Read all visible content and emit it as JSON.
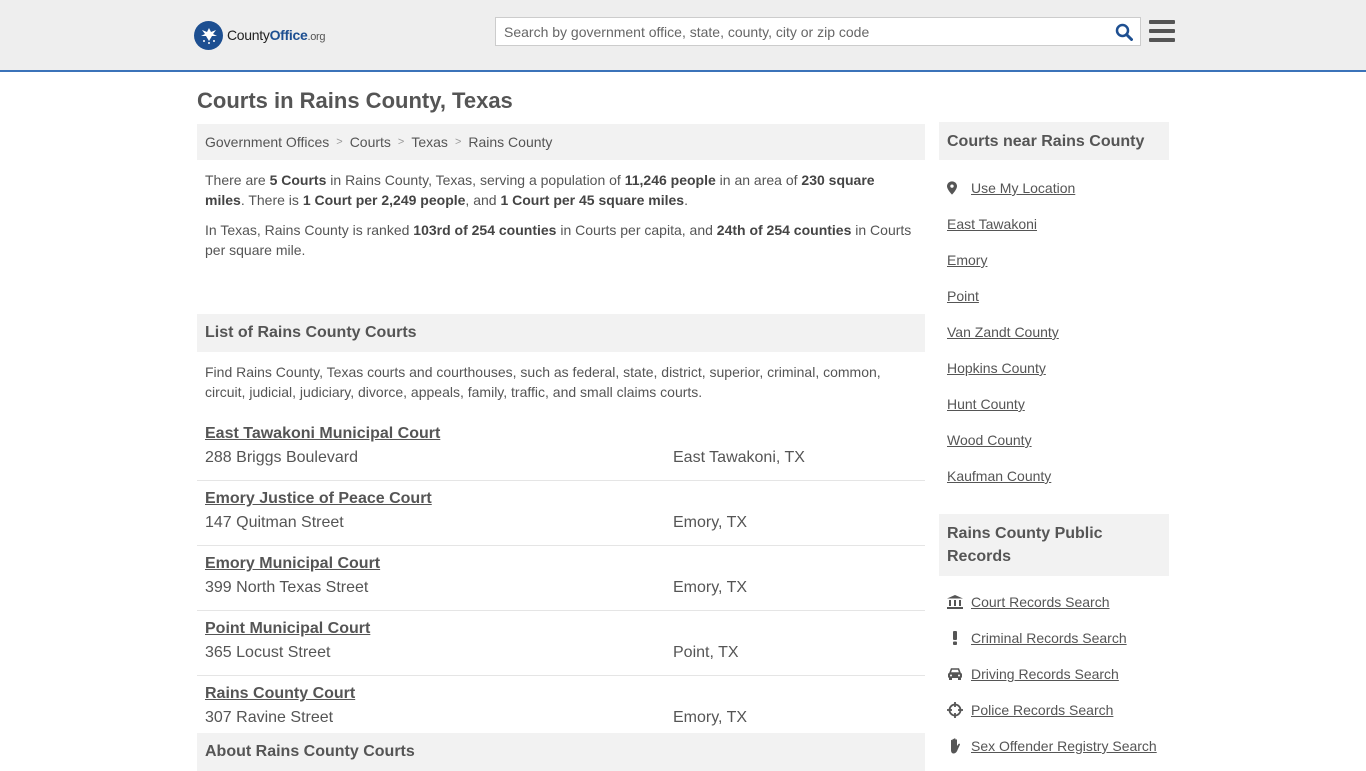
{
  "header": {
    "logo_text_main": "County",
    "logo_text_office": "Office",
    "logo_text_org": ".org",
    "search_placeholder": "Search by government office, state, county, city or zip code"
  },
  "page_title": "Courts in Rains County, Texas",
  "breadcrumb": [
    "Government Offices",
    "Courts",
    "Texas",
    "Rains County"
  ],
  "intro": {
    "p1": {
      "t1": "There are ",
      "b1": "5 Courts",
      "t2": " in Rains County, Texas, serving a population of ",
      "b2": "11,246 people",
      "t3": " in an area of ",
      "b3": "230 square miles",
      "t4": ". There is ",
      "b4": "1 Court per 2,249 people",
      "t5": ", and ",
      "b5": "1 Court per 45 square miles",
      "t6": "."
    },
    "p2": {
      "t1": "In Texas, Rains County is ranked ",
      "b1": "103rd of 254 counties",
      "t2": " in Courts per capita, and ",
      "b2": "24th of 254 counties",
      "t3": " in Courts per square mile."
    }
  },
  "list_section": {
    "title": "List of Rains County Courts",
    "description": "Find Rains County, Texas courts and courthouses, such as federal, state, district, superior, criminal, common, circuit, judicial, judiciary, divorce, appeals, family, traffic, and small claims courts."
  },
  "courts": [
    {
      "name": "East Tawakoni Municipal Court",
      "address": "288 Briggs Boulevard",
      "city": "East Tawakoni, TX"
    },
    {
      "name": "Emory Justice of Peace Court",
      "address": "147 Quitman Street",
      "city": "Emory, TX"
    },
    {
      "name": "Emory Municipal Court",
      "address": "399 North Texas Street",
      "city": "Emory, TX"
    },
    {
      "name": "Point Municipal Court",
      "address": "365 Locust Street",
      "city": "Point, TX"
    },
    {
      "name": "Rains County Court",
      "address": "307 Ravine Street",
      "city": "Emory, TX"
    }
  ],
  "about_section": {
    "title": "About Rains County Courts"
  },
  "sidebar": {
    "nearby_title": "Courts near Rains County",
    "use_location": "Use My Location",
    "nearby": [
      "East Tawakoni",
      "Emory",
      "Point",
      "Van Zandt County",
      "Hopkins County",
      "Hunt County",
      "Wood County",
      "Kaufman County"
    ],
    "records_title": "Rains County Public Records",
    "records": [
      {
        "label": "Court Records Search",
        "icon": "courthouse-icon"
      },
      {
        "label": "Criminal Records Search",
        "icon": "exclamation-icon"
      },
      {
        "label": "Driving Records Search",
        "icon": "car-icon"
      },
      {
        "label": "Police Records Search",
        "icon": "crosshair-icon"
      },
      {
        "label": "Sex Offender Registry Search",
        "icon": "hand-icon"
      }
    ]
  },
  "colors": {
    "accent": "#3b73b9",
    "header_bg": "#eeeeee",
    "panel_bg": "#f2f2f2",
    "text": "#555555",
    "logo_blue": "#1d4f91"
  }
}
